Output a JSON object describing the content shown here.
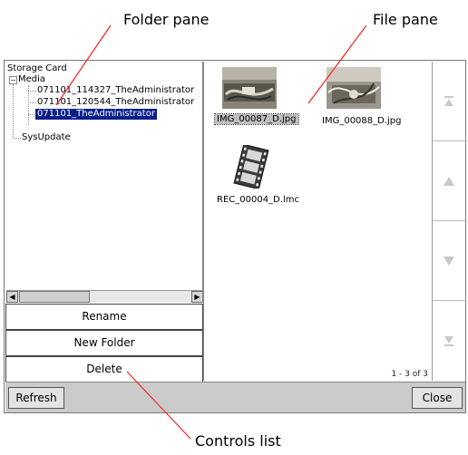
{
  "callouts": {
    "folder_pane": "Folder pane",
    "file_pane": "File pane",
    "controls_list": "Controls list"
  },
  "tree": {
    "root": "Storage Card",
    "media": "Media",
    "items": [
      "071101_114327_TheAdministrator",
      "071101_120544_TheAdministrator",
      "071101_TheAdministrator"
    ],
    "selected_index": 2,
    "sysupdate": "SysUpdate"
  },
  "controls": {
    "rename": "Rename",
    "new_folder": "New Folder",
    "delete": "Delete"
  },
  "files": [
    {
      "name": "IMG_00087_D.jpg",
      "icon": "photo-thumbnail-icon",
      "selected": true
    },
    {
      "name": "IMG_00088_D.jpg",
      "icon": "photo-thumbnail-icon",
      "selected": false
    },
    {
      "name": "REC_00004_D.lmc",
      "icon": "film-strip-icon",
      "selected": false
    }
  ],
  "file_count": "1 - 3 of 3",
  "side_buttons": [
    "first-page-icon",
    "up-arrow-icon",
    "down-arrow-icon",
    "last-page-icon"
  ],
  "bar": {
    "refresh": "Refresh",
    "close": "Close"
  },
  "colors": {
    "selection": "#0a1e8a",
    "bar": "#cbcbcb"
  }
}
